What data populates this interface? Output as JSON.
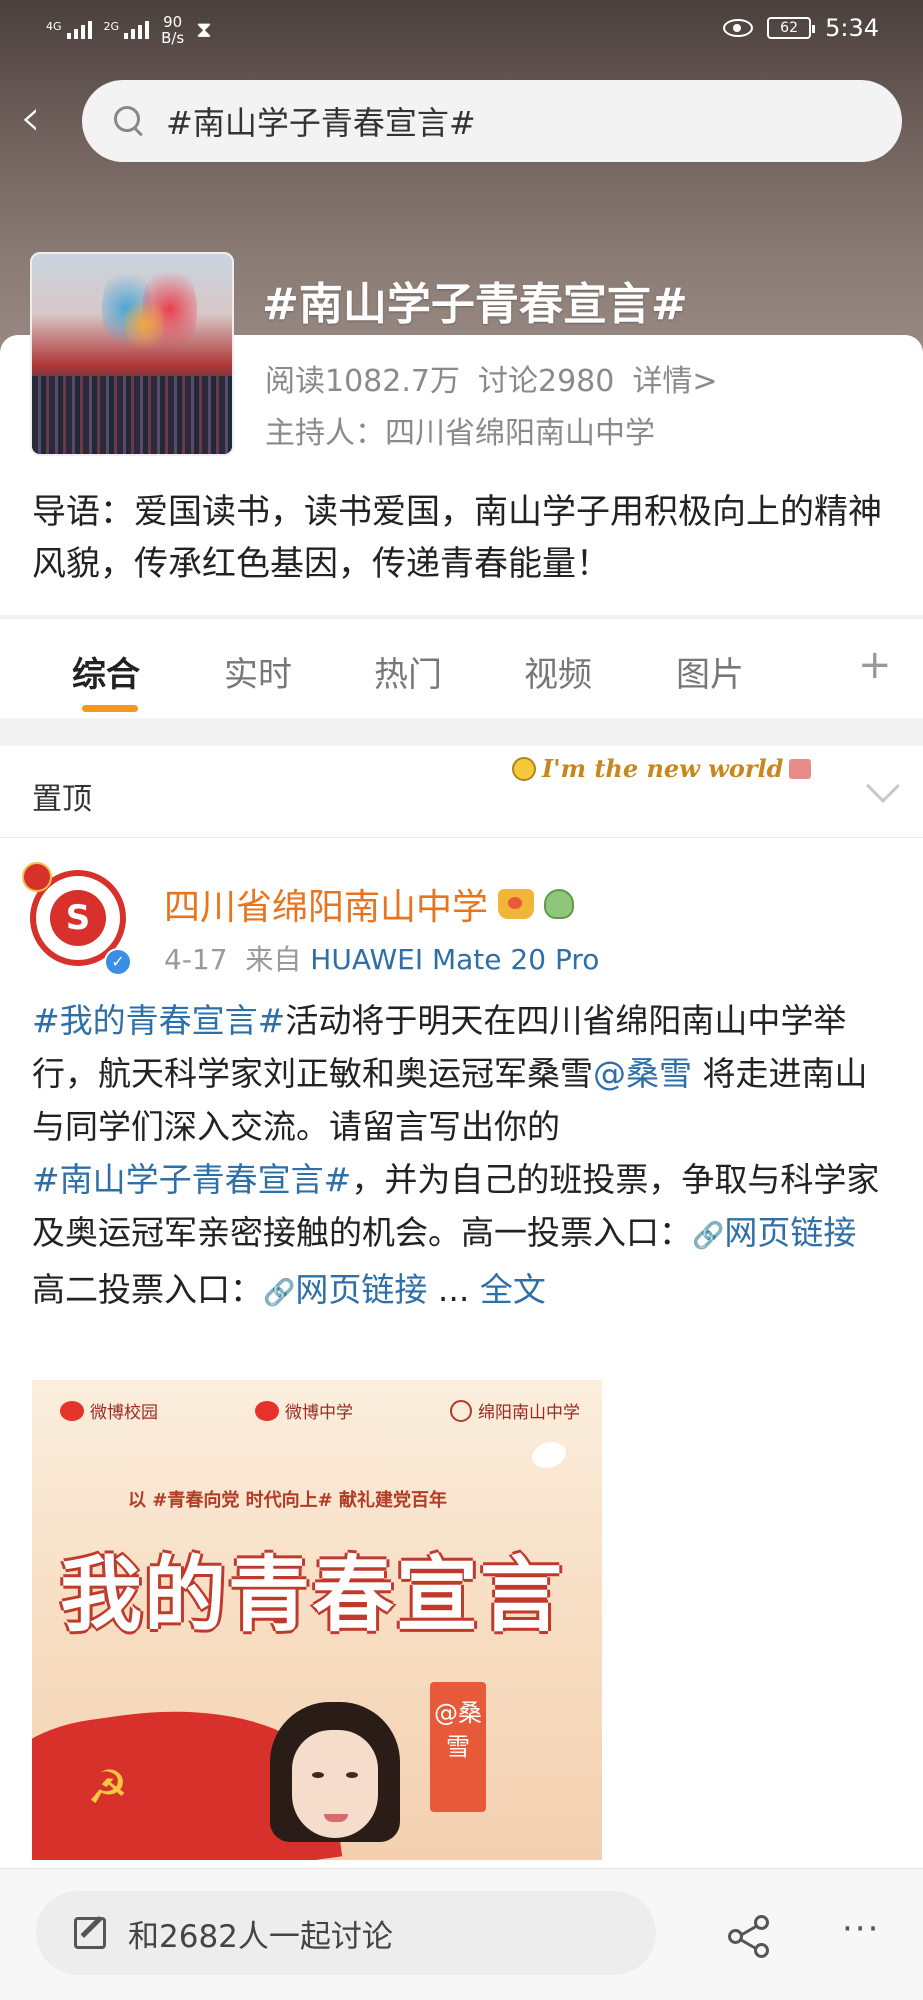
{
  "status_bar": {
    "signal1_label": "4G",
    "signal2_label": "2G",
    "net_speed_value": "90",
    "net_speed_unit": "B/s",
    "battery": "62",
    "time": "5:34"
  },
  "search": {
    "query": "#南山学子青春宣言#"
  },
  "topic": {
    "title": "#南山学子青春宣言#",
    "reads": "阅读1082.7万",
    "discussions": "讨论2980",
    "details": "详情>",
    "host": "主持人：四川省绵阳南山中学",
    "intro": "导语：爱国读书，读书爱国，南山学子用积极向上的精神风貌，传承红色基因，传递青春能量！"
  },
  "tabs": [
    {
      "label": "综合"
    },
    {
      "label": "实时"
    },
    {
      "label": "热门"
    },
    {
      "label": "视频"
    },
    {
      "label": "图片"
    }
  ],
  "tab_add": "+",
  "pinned": {
    "label": "置顶",
    "sticker_text": "I'm the new world"
  },
  "post": {
    "author": "四川省绵阳南山中学",
    "date": "4-17",
    "source_prefix": "来自",
    "device": "HUAWEI Mate 20 Pro",
    "text": {
      "tag1": "#我的青春宣言#",
      "p1": "活动将于明天在四川省绵阳南山中学举行，航天科学家刘正敏和奥运冠军桑雪",
      "mention": "@桑雪",
      "p2": " 将走进南山与同学们深入交流。请留言写出你的",
      "tag2": "#南山学子青春宣言#",
      "p3": "，并为自己的班投票，争取与科学家及奥运冠军亲密接触的机会。高一投票入口：",
      "link1": "网页链接",
      "p4": "高二投票入口：",
      "link2": "网页链接",
      "ellipsis": " ... ",
      "full_text": "全文"
    },
    "image": {
      "logo1": "微博校园",
      "logo2": "微博中学",
      "logo3": "绵阳南山中学",
      "subtitle": "以 #青春向党 时代向上# 献礼建党百年",
      "title": "我的青春宣言",
      "ribbon": "@桑雪"
    }
  },
  "bottom_bar": {
    "comment_placeholder": "和2682人一起讨论",
    "more": "···"
  },
  "colors": {
    "accent_orange": "#f29a1f",
    "author_orange": "#e8741e",
    "link_blue": "#2f6fa8"
  }
}
